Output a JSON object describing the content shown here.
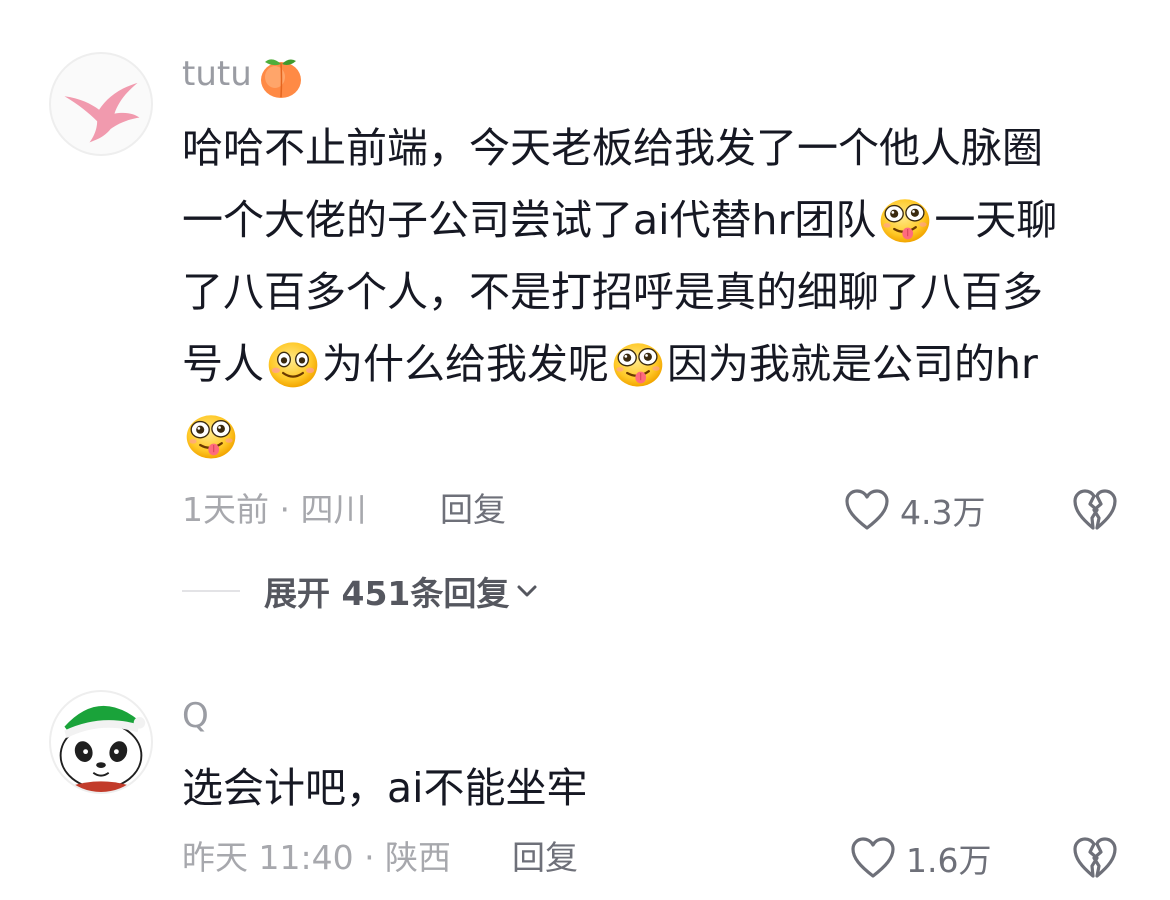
{
  "comments": [
    {
      "username": "tutu",
      "username_emoji": "peach-emoji",
      "lines": [
        {
          "a": "哈哈不止前端，今天老板给我发了一个他人脉圈"
        },
        {
          "a": "一个大佬的子公司尝试了ai代替hr团队",
          "emoji": "drooling-face-emoji",
          "b": "一天聊"
        },
        {
          "a": "了八百多个人，不是打招呼是真的细聊了八百多"
        },
        {
          "a": "号人",
          "emoji": "smiling-face-emoji",
          "b": "为什么给我发呢",
          "emoji2": "drooling-face-emoji",
          "c": "因为我就是公司的hr"
        },
        {
          "emoji": "drooling-face-emoji"
        }
      ],
      "meta": "1天前 · 四川",
      "reply_label": "回复",
      "like_count": "4.3万"
    },
    {
      "username": "Q",
      "text": "选会计吧，ai不能坐牢",
      "meta": "昨天 11:40 · 陕西",
      "reply_label": "回复",
      "like_count": "1.6万"
    }
  ],
  "expand_replies": {
    "label": "展开 451条回复"
  },
  "colors": {
    "text": "#161823",
    "secondary": "#a7a8ad",
    "username": "#9a9ca3",
    "action": "#6e7079"
  },
  "icons": {
    "like": "heart-outline-icon",
    "dislike": "broken-heart-icon",
    "expand": "chevron-down-icon"
  }
}
